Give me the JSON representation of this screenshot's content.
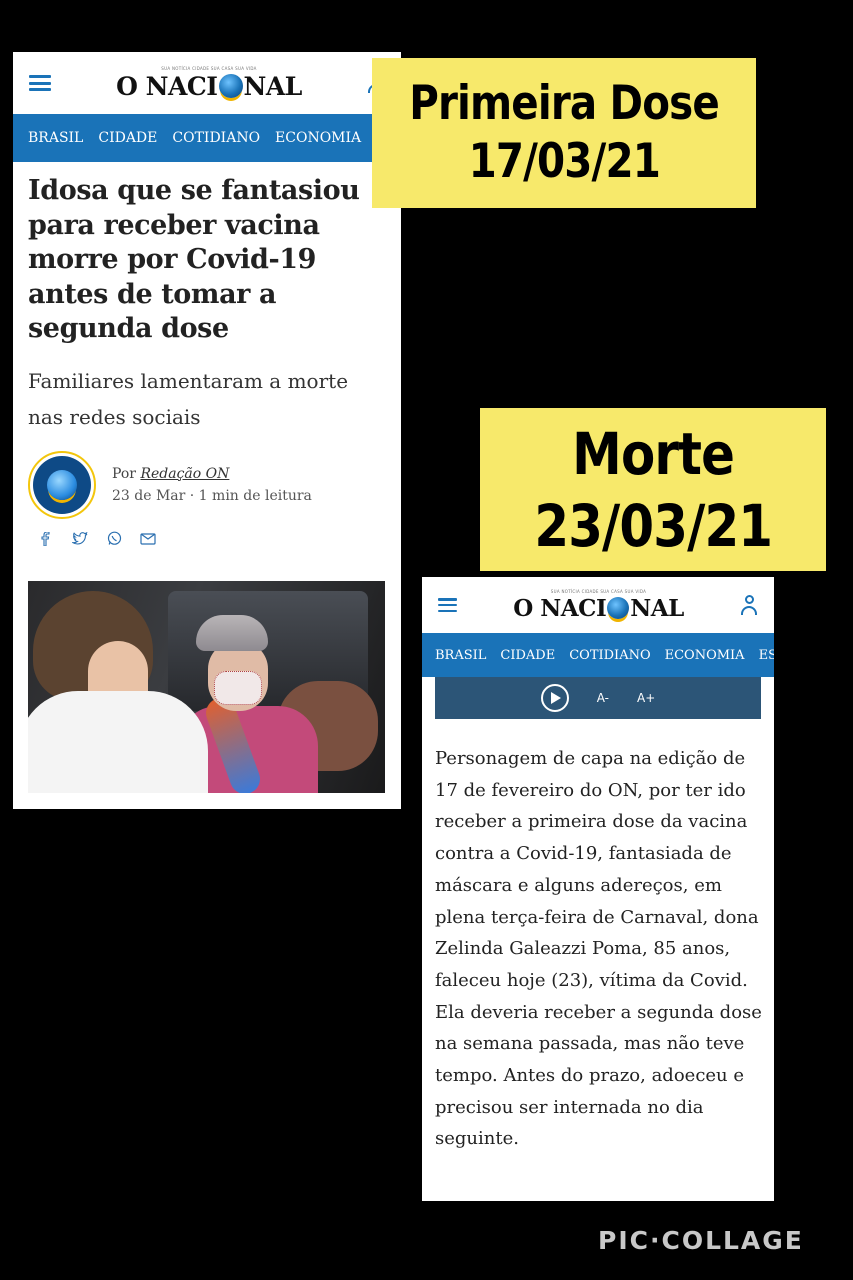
{
  "article1": {
    "logo": {
      "tagline": "SUA NOTÍCIA CIDADE SUA CASA SUA VIDA",
      "left": "O NACI",
      "right": "NAL"
    },
    "nav": [
      "BRASIL",
      "CIDADE",
      "COTIDIANO",
      "ECONOMIA"
    ],
    "headline": "Idosa que se fantasiou para receber vacina morre por Covid-19 antes de tomar a segunda dose",
    "subhead": "Familiares lamentaram a morte nas redes sociais",
    "byline": {
      "by": "Por",
      "author": "Redação ON",
      "meta": "23 de Mar · 1 min de leitura"
    }
  },
  "label1": {
    "line1": "Primeira Dose",
    "line2": "17/03/21"
  },
  "label2": {
    "line1": "Morte",
    "line2": "23/03/21"
  },
  "article2": {
    "logo": {
      "tagline": "SUA NOTÍCIA CIDADE SUA CASA SUA VIDA",
      "left": "O NACI",
      "right": "NAL"
    },
    "nav": [
      "BRASIL",
      "CIDADE",
      "COTIDIANO",
      "ECONOMIA",
      "ESP"
    ],
    "player": {
      "decrease": "A-",
      "increase": "A+"
    },
    "body": "Personagem de capa na edição de 17 de fevereiro do ON, por ter ido receber a primeira dose da vacina contra a Covid-19, fantasiada de máscara e alguns adereços, em plena terça-feira de Carnaval, dona Zelinda Galeazzi Poma, 85 anos, faleceu hoje (23), vítima da Covid. Ela deveria receber a segunda dose na semana passada, mas não teve tempo. Antes do prazo, adoeceu e precisou ser internada no dia seguinte."
  },
  "watermark": "PIC·COLLAGE",
  "colors": {
    "nav_blue": "#1a73b8",
    "label_yellow": "#f7e96b",
    "player_blue": "#2c5577"
  }
}
